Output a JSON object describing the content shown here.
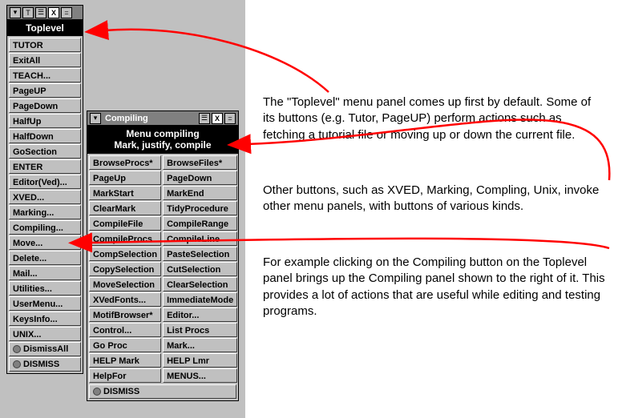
{
  "toplevel": {
    "window_title": "",
    "titlebar_icons": [
      "T",
      "☰",
      "X",
      "="
    ],
    "header": "Toplevel",
    "buttons": [
      "TUTOR",
      "ExitAll",
      "TEACH...",
      "PageUP",
      "PageDown",
      "HalfUp",
      "HalfDown",
      "GoSection",
      "ENTER",
      "Editor(Ved)...",
      "XVED...",
      "Marking...",
      "Compiling...",
      "Move...",
      "Delete...",
      "Mail...",
      "Utilities...",
      "UserMenu...",
      "KeysInfo...",
      "UNIX..."
    ],
    "dismiss_all": "DismissAll",
    "dismiss": "DISMISS"
  },
  "compiling": {
    "window_title": "Compiling",
    "titlebar_icons": [
      "☰",
      "X",
      "="
    ],
    "header_line1": "Menu compiling",
    "header_line2": "Mark, justify, compile",
    "left_col": [
      "BrowseProcs*",
      "PageUp",
      "MarkStart",
      "ClearMark",
      "CompileFile",
      "CompileProcs",
      "CompSelection",
      "CopySelection",
      "MoveSelection",
      "XVedFonts...",
      "MotifBrowser*",
      "Control...",
      "Go Proc",
      "HELP Mark",
      "HelpFor"
    ],
    "right_col": [
      "BrowseFiles*",
      "PageDown",
      "MarkEnd",
      "TidyProcedure",
      "CompileRange",
      "CompileLine",
      "PasteSelection",
      "CutSelection",
      "ClearSelection",
      "ImmediateMode",
      "Editor...",
      "List Procs",
      "Mark...",
      "HELP Lmr",
      "MENUS..."
    ],
    "dismiss": "DISMISS"
  },
  "explain": {
    "p1": "The \"Toplevel\" menu panel comes up first by default. Some of its buttons (e.g. Tutor, PageUP) perform actions such as fetching a tutorial file or moving up or down the current file.",
    "p2": "Other buttons, such as XVED, Marking, Compling, Unix, invoke other menu panels, with buttons of various kinds.",
    "p3": "For example clicking on the Compiling button on the Toplevel panel brings up the Compiling panel shown to the right of it. This provides a lot of actions that are useful while editing and testing programs."
  }
}
